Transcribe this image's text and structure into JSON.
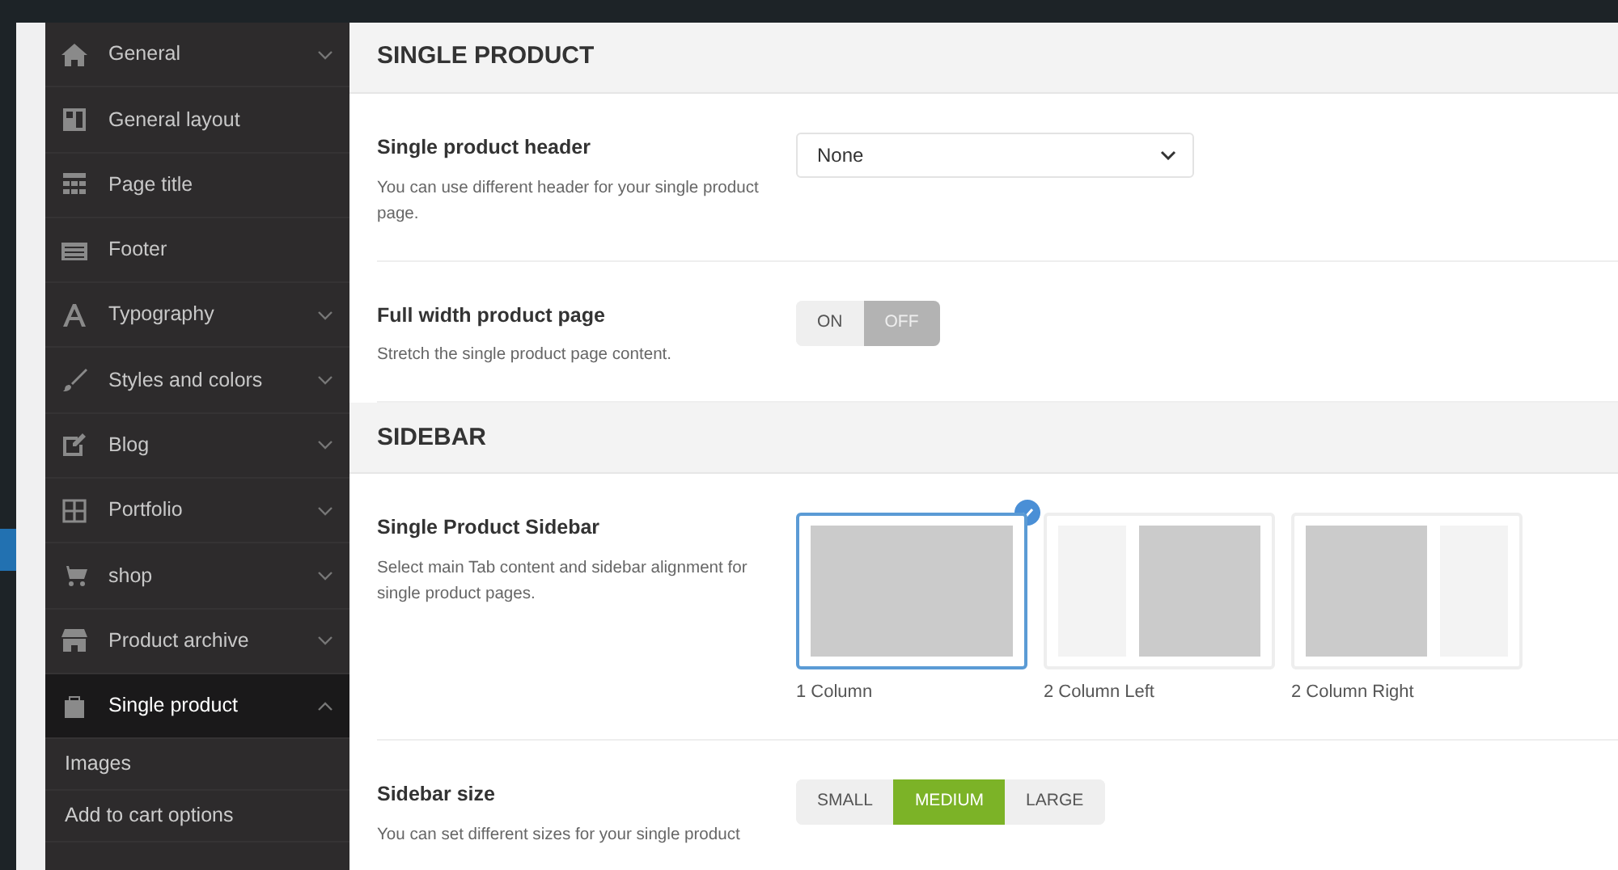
{
  "sidebar": {
    "items": [
      {
        "label": "General",
        "expanded": false,
        "selected": false
      },
      {
        "label": "General layout",
        "selected": false
      },
      {
        "label": "Page title",
        "selected": false
      },
      {
        "label": "Footer",
        "selected": false
      },
      {
        "label": "Typography",
        "expanded": false,
        "selected": false
      },
      {
        "label": "Styles and colors",
        "expanded": false,
        "selected": false
      },
      {
        "label": "Blog",
        "expanded": false,
        "selected": false
      },
      {
        "label": "Portfolio",
        "expanded": false,
        "selected": false
      },
      {
        "label": "shop",
        "expanded": false,
        "selected": false
      },
      {
        "label": "Product archive",
        "expanded": false,
        "selected": false
      },
      {
        "label": "Single product",
        "expanded": true,
        "selected": true,
        "children": [
          {
            "label": "Images"
          },
          {
            "label": "Add to cart options"
          }
        ]
      }
    ]
  },
  "sections": [
    {
      "title": "SINGLE PRODUCT",
      "options": [
        {
          "kind": "select",
          "label": "Single product header",
          "description": "You can use different header for your single product page.",
          "value": "None"
        },
        {
          "kind": "toggle",
          "label": "Full width product page",
          "description": "Stretch the single product page content.",
          "choices": [
            {
              "label": "ON",
              "selected": false
            },
            {
              "label": "OFF",
              "selected": true
            }
          ]
        }
      ]
    },
    {
      "title": "SIDEBAR",
      "options": [
        {
          "kind": "layout",
          "label": "Single Product Sidebar",
          "description": "Select main Tab content and sidebar alignment for single product pages.",
          "choices": [
            {
              "label": "1 Column",
              "kind": "full",
              "selected": true
            },
            {
              "label": "2 Column Left",
              "kind": "left",
              "selected": false
            },
            {
              "label": "2 Column Right",
              "kind": "right",
              "selected": false
            }
          ]
        },
        {
          "kind": "buttons",
          "label": "Sidebar size",
          "description": "You can set different sizes for your single product",
          "choices": [
            {
              "label": "SMALL",
              "selected": false
            },
            {
              "label": "MEDIUM",
              "selected": true
            },
            {
              "label": "LARGE",
              "selected": false
            }
          ]
        }
      ]
    }
  ]
}
